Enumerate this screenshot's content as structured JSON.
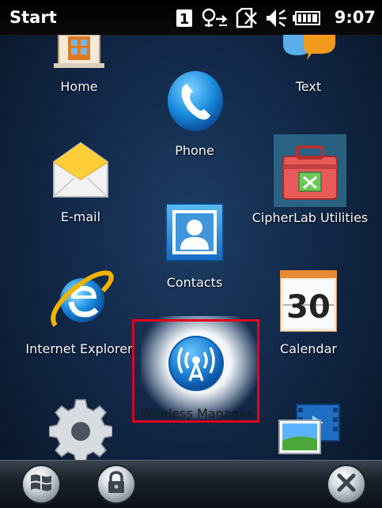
{
  "status_bar": {
    "title": "Start",
    "sim_indicator": "1",
    "time": "9:07",
    "icons": [
      "sim-1-icon",
      "network-sync-icon",
      "no-sim-card-icon",
      "volume-icon",
      "battery-icon"
    ]
  },
  "apps": [
    {
      "id": "home",
      "label": "Home",
      "icon": "home-icon"
    },
    {
      "id": "text",
      "label": "Text",
      "icon": "text-message-icon"
    },
    {
      "id": "phone",
      "label": "Phone",
      "icon": "phone-icon"
    },
    {
      "id": "email",
      "label": "E-mail",
      "icon": "email-envelope-icon"
    },
    {
      "id": "cipherlab",
      "label": "CipherLab Utilities",
      "icon": "toolbox-icon"
    },
    {
      "id": "contacts",
      "label": "Contacts",
      "icon": "contacts-icon"
    },
    {
      "id": "ie",
      "label": "Internet Explorer",
      "icon": "internet-explorer-icon"
    },
    {
      "id": "calendar",
      "label": "Calendar",
      "icon": "calendar-icon",
      "date": "30"
    },
    {
      "id": "wireless",
      "label": "Wireless Manager",
      "icon": "wireless-antenna-icon",
      "selected": true
    },
    {
      "id": "settings",
      "label": "",
      "icon": "settings-gear-icon"
    },
    {
      "id": "pictures",
      "label": "",
      "icon": "pictures-videos-icon"
    }
  ],
  "bottom_bar": {
    "buttons": [
      "windows-start-icon",
      "lock-icon",
      "close-icon"
    ]
  },
  "colors": {
    "highlight": "#e3001b",
    "background": "#12294a"
  }
}
